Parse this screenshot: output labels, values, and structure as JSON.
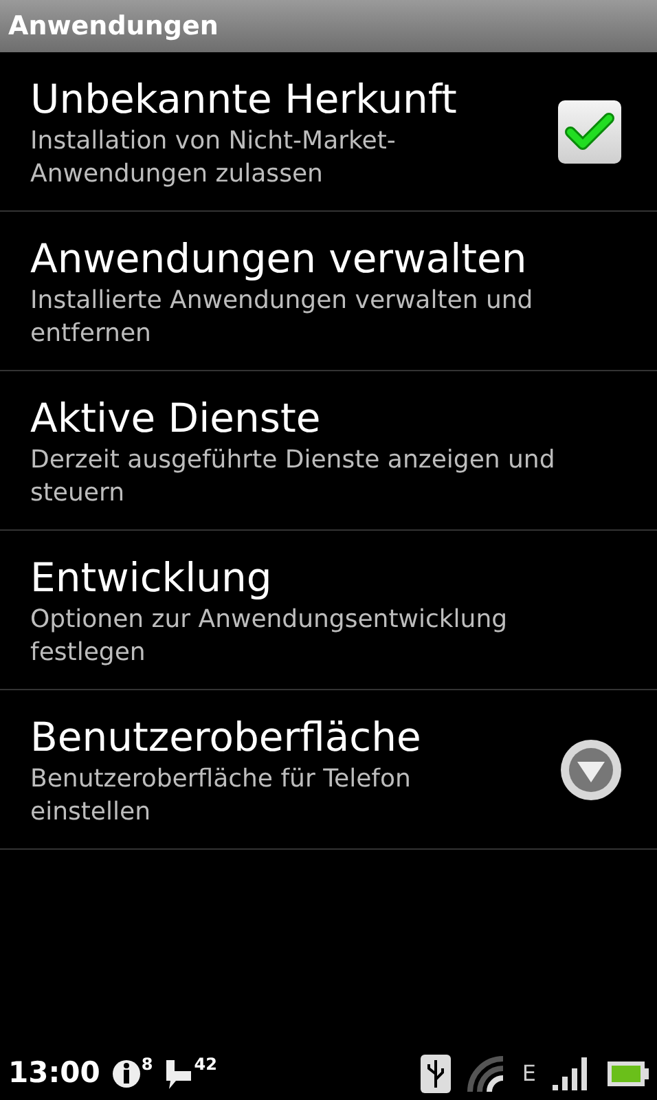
{
  "title_bar": {
    "title": "Anwendungen"
  },
  "items": [
    {
      "kind": "checkbox",
      "title": "Unbekannte Herkunft",
      "summary": "Installation von Nicht-Market-Anwendungen zulassen",
      "checked": true
    },
    {
      "kind": "plain",
      "title": "Anwendungen verwalten",
      "summary": "Installierte Anwendungen verwalten und entfernen"
    },
    {
      "kind": "plain",
      "title": "Aktive Dienste",
      "summary": "Derzeit ausgeführte Dienste anzeigen und steuern"
    },
    {
      "kind": "plain",
      "title": "Entwicklung",
      "summary": "Optionen zur Anwendungsentwicklung festlegen"
    },
    {
      "kind": "dropdown",
      "title": "Benutzeroberfläche",
      "summary": "Benutzeroberfläche für Telefon einstellen"
    }
  ],
  "status_bar": {
    "time": "13:00",
    "info_count": "8",
    "message_count": "42",
    "network": "E"
  }
}
